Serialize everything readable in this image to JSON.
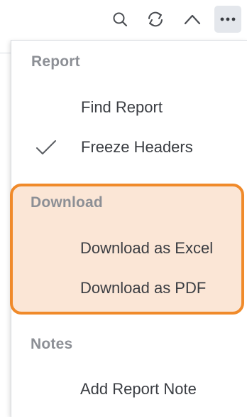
{
  "toolbar": {
    "icons": [
      "search-icon",
      "refresh-icon",
      "chevron-up-icon",
      "more-icon"
    ]
  },
  "menu": {
    "sections": [
      {
        "header": "Report",
        "items": [
          {
            "label": "Find Report",
            "checked": false
          },
          {
            "label": "Freeze Headers",
            "checked": true
          }
        ]
      },
      {
        "header": "Download",
        "items": [
          {
            "label": "Download as Excel",
            "checked": false
          },
          {
            "label": "Download as PDF",
            "checked": false
          }
        ]
      },
      {
        "header": "Notes",
        "items": [
          {
            "label": "Add Report Note",
            "checked": false
          }
        ]
      }
    ]
  },
  "colors": {
    "highlight_fill": "#fbe6d6",
    "highlight_border": "#f08a2a",
    "header_text": "#8c8f95",
    "item_text": "#3a3d42"
  }
}
